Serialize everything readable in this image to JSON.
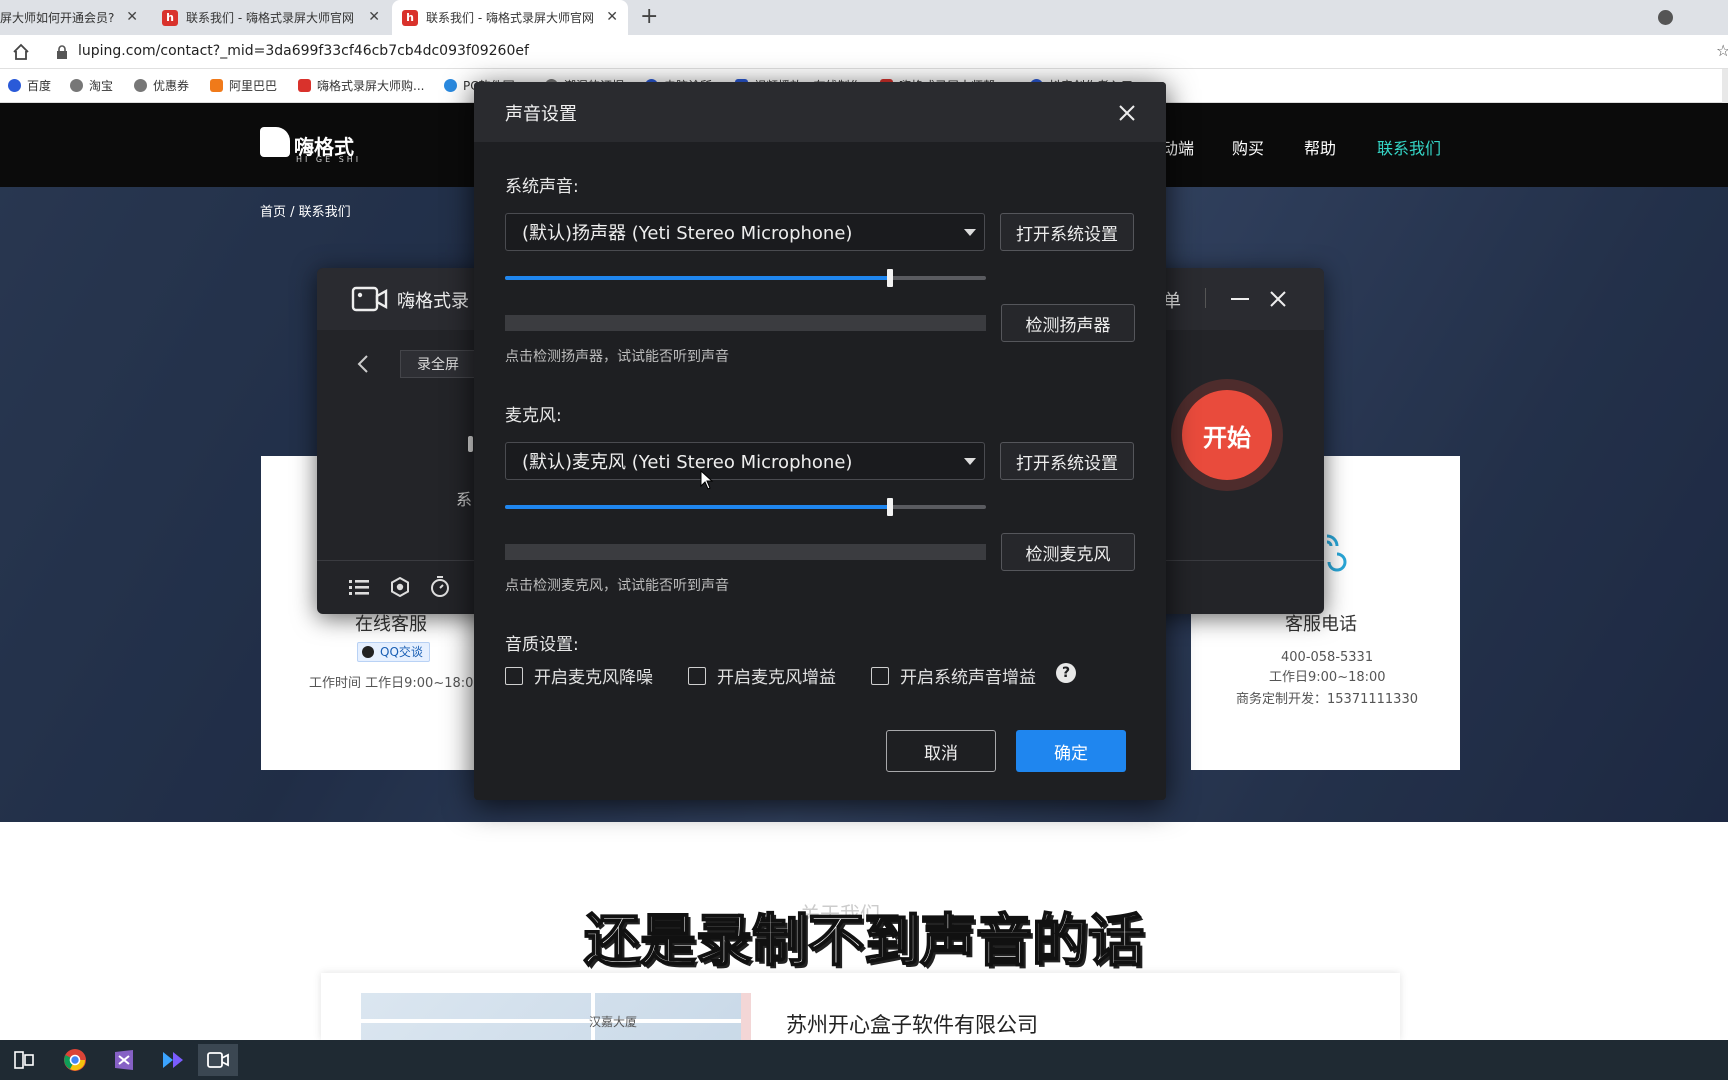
{
  "browser": {
    "tabs": [
      {
        "title": "屏大师如何开通会员?",
        "active": false
      },
      {
        "title": "联系我们 - 嗨格式录屏大师官网",
        "active": false
      },
      {
        "title": "联系我们 - 嗨格式录屏大师官网",
        "active": true
      }
    ],
    "new_tab": "+",
    "url": "luping.com/contact?_mid=3da699f33cf46cb7cb4dc093f09260ef",
    "bookmarks": [
      "百度",
      "淘宝",
      "优惠券",
      "阿里巴巴",
      "嗨格式录屏大师购...",
      "PC软件园",
      "潮湿的证据",
      "电脑诊所",
      "视频播放 · 在线制作",
      "嗨格式录屏大师帮",
      "抖音创作者入口"
    ]
  },
  "site": {
    "logo_text": "嗨格式",
    "logo_sub": "HI GE SHI",
    "nav": [
      "动端",
      "购买",
      "帮助",
      "联系我们"
    ],
    "breadcrumb": "首页 / 联系我们",
    "online_service": {
      "title": "在线客服",
      "qq_badge": "QQ交谈",
      "hours": "工作时间 工作日9:00~18:00"
    },
    "phone_service": {
      "title": "客服电话",
      "phone": "400-058-5331",
      "hours": "工作日9:00~18:00",
      "business": "商务定制开发：15371111330"
    },
    "section_title": "关于我们",
    "company": "苏州开心盒子软件有限公司",
    "map_label": "汉嘉大厦"
  },
  "recorder": {
    "title": "嗨格式录",
    "menu_fragment": "单",
    "mode": "录全屏",
    "side_text": "系",
    "start_label": "开始"
  },
  "dialog": {
    "title": "声音设置",
    "system_sound_label": "系统声音:",
    "speaker_device": "(默认)扬声器 (Yeti Stereo Microphone)",
    "open_system_settings": "打开系统设置",
    "speaker_volume": 0.8,
    "test_speaker": "检测扬声器",
    "speaker_hint": "点击检测扬声器，试试能否听到声音",
    "mic_label": "麦克风:",
    "mic_device": "(默认)麦克风 (Yeti Stereo Microphone)",
    "mic_volume": 0.8,
    "test_mic": "检测麦克风",
    "mic_hint": "点击检测麦克风，试试能否听到声音",
    "quality_label": "音质设置:",
    "options": [
      {
        "label": "开启麦克风降噪",
        "checked": false
      },
      {
        "label": "开启麦克风增益",
        "checked": false
      },
      {
        "label": "开启系统声音增益",
        "checked": false
      }
    ],
    "help_glyph": "?",
    "cancel": "取消",
    "ok": "确定"
  },
  "subtitle": "还是录制不到声音的话",
  "colors": {
    "accent": "#1f86ef",
    "start": "#e94b3c",
    "nav_active": "#35d6c7"
  }
}
